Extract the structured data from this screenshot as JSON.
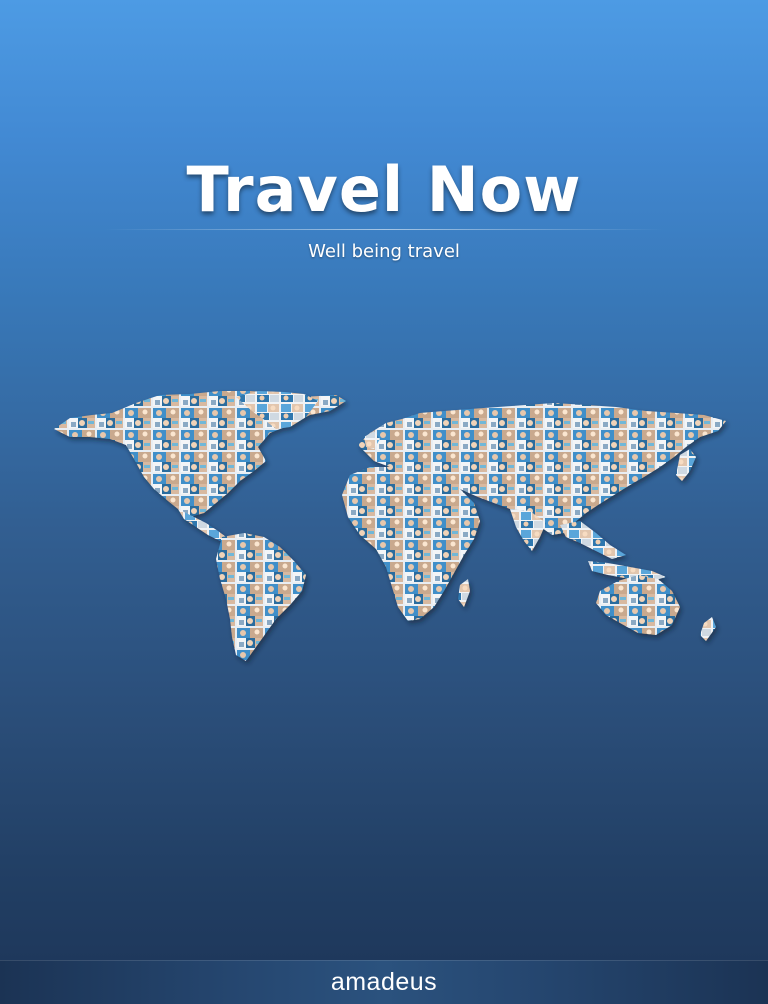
{
  "header": {
    "title": "Travel Now",
    "subtitle": "Well being travel"
  },
  "footer": {
    "brand": "amadeus"
  },
  "colors": {
    "background_top": "#4d9be4",
    "background_bottom": "#1d3558",
    "title_text": "#ffffff",
    "footer_bar": "#25466f"
  },
  "illustration": {
    "name": "world-map-photo-collage"
  }
}
